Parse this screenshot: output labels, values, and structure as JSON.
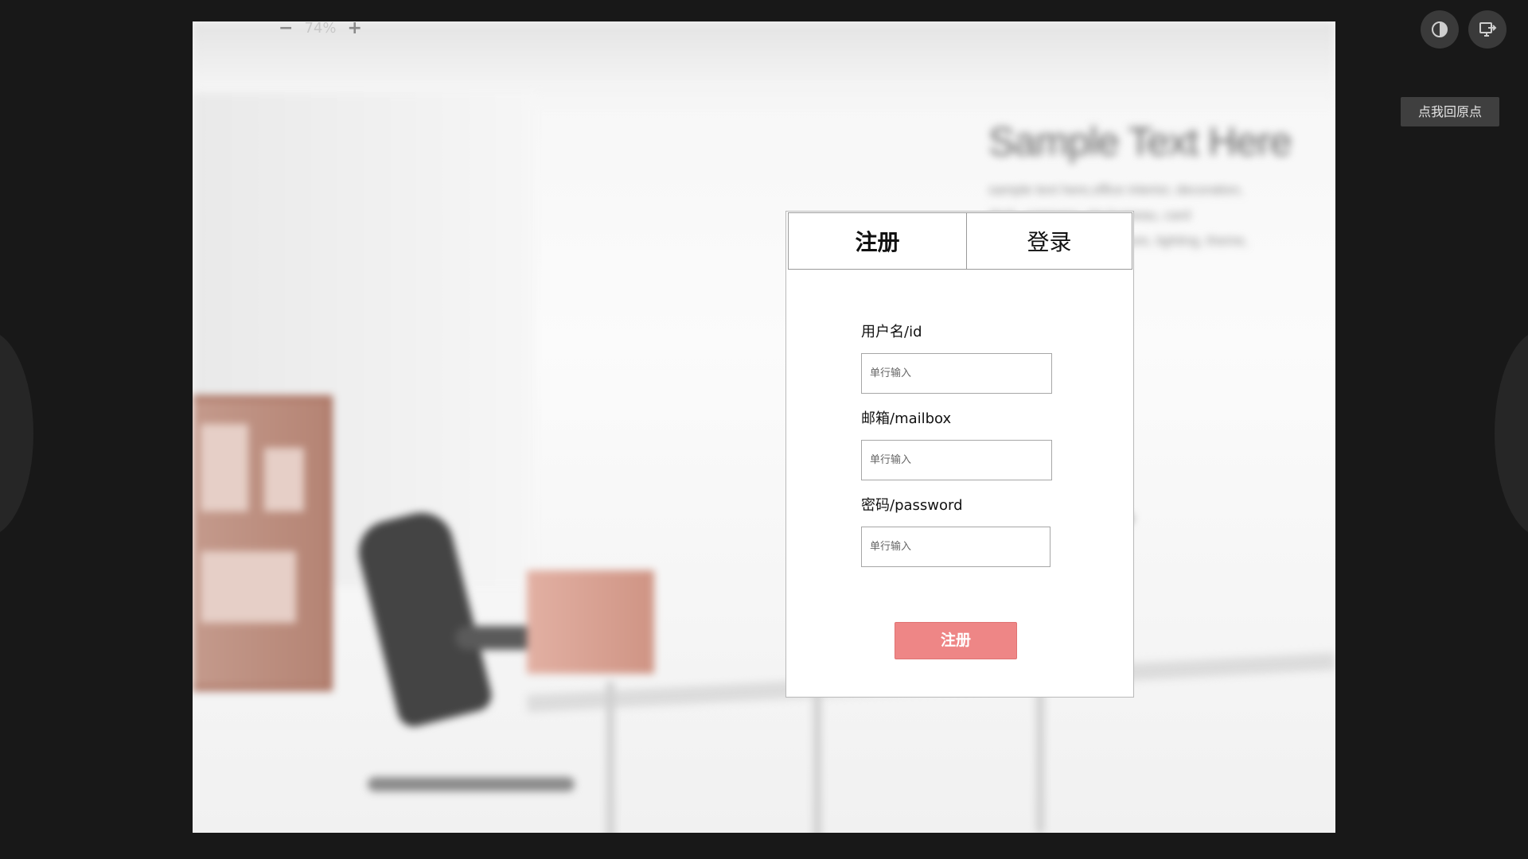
{
  "toolbar": {
    "zoom_minus": "−",
    "zoom_value": "74%",
    "zoom_plus": "+",
    "return_origin": "点我回原点",
    "theme_icon": "contrast-icon",
    "exit_icon": "exit-presentation-icon"
  },
  "background": {
    "sample_title": "Sample Text Here",
    "sample_body": "sample text here,office interior, decoration, desk, company, ela bumeau, card information, chair, furniture, lighting, theme, design, aesthetics, text."
  },
  "form": {
    "tabs": [
      {
        "label": "注册",
        "active": true
      },
      {
        "label": "登录",
        "active": false
      }
    ],
    "fields": [
      {
        "label": "用户名/id",
        "placeholder": "单行输入",
        "value": ""
      },
      {
        "label": "邮箱/mailbox",
        "placeholder": "单行输入",
        "value": ""
      },
      {
        "label": "密码/password",
        "placeholder": "单行输入",
        "value": ""
      }
    ],
    "submit_label": "注册",
    "submit_color": "#ee8686"
  }
}
